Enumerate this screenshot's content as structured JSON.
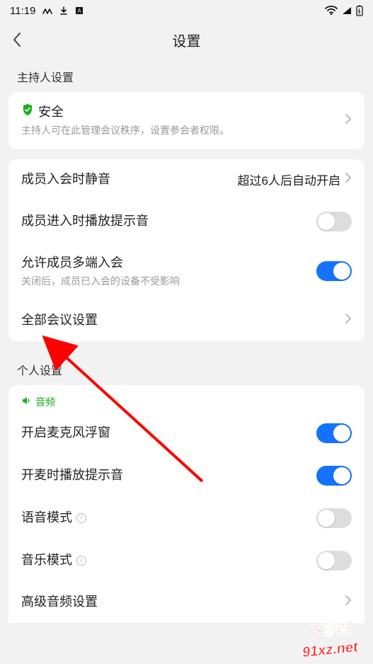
{
  "status": {
    "time": "11:19"
  },
  "header": {
    "title": "设置"
  },
  "sections": {
    "host": {
      "heading": "主持人设置",
      "security": {
        "title": "安全",
        "subtitle": "主持人可在此管理会议秩序，设置参会者权限。"
      },
      "muteOnJoin": {
        "title": "成员入会时静音",
        "value": "超过6人后自动开启"
      },
      "joinSound": {
        "title": "成员进入时播放提示音"
      },
      "multiDevice": {
        "title": "允许成员多端入会",
        "subtitle": "关闭后，成员已入会的设备不受影响"
      },
      "allMeetingSettings": {
        "title": "全部会议设置"
      }
    },
    "personal": {
      "heading": "个人设置",
      "audioLabel": "音频",
      "micFloat": {
        "title": "开启麦克风浮窗"
      },
      "unmuteSound": {
        "title": "开麦时播放提示音"
      },
      "voiceMode": {
        "title": "语音模式"
      },
      "musicMode": {
        "title": "音乐模式"
      },
      "advancedAudio": {
        "title": "高级音频设置"
      }
    }
  },
  "watermark": {
    "top": "下载站",
    "bottom": "91xz.net"
  }
}
